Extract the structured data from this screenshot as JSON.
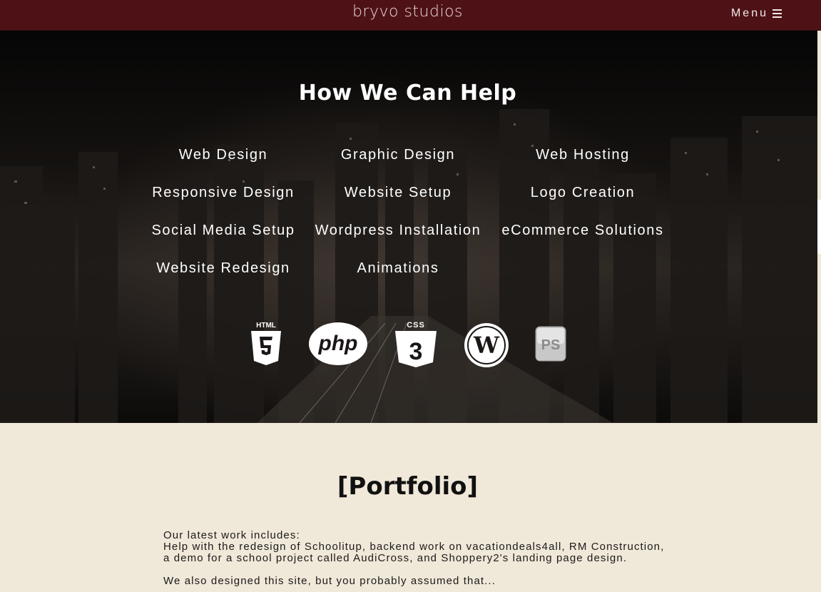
{
  "navbar": {
    "brand": "bryvo studios",
    "menu_label": "Menu",
    "background": "#4e1216"
  },
  "services": {
    "title": "How We Can Help",
    "items": [
      "Web Design",
      "Graphic Design",
      "Web Hosting",
      "Responsive Design",
      "Website Setup",
      "Logo Creation",
      "Social Media Setup",
      "Wordpress Installation",
      "eCommerce Solutions",
      "Website Redesign",
      "Animations"
    ],
    "tech_icons": [
      {
        "name": "html5-icon",
        "label": "HTML"
      },
      {
        "name": "php-icon",
        "label": "php"
      },
      {
        "name": "css3-icon",
        "label": "CSS"
      },
      {
        "name": "wordpress-icon",
        "label": "W"
      },
      {
        "name": "photoshop-icon",
        "label": "PS"
      }
    ]
  },
  "portfolio": {
    "title": "[Portfolio]",
    "intro": "Our latest work includes:",
    "line1": "Help with the redesign of Schoolitup, backend work on vacationdeals4all, RM Construction,",
    "line2": "a demo for a school project called AudiCross, and Shoppery2's landing page design.",
    "line3": "We also designed this site, but you probably assumed that...",
    "background": "#f0e8d8"
  }
}
